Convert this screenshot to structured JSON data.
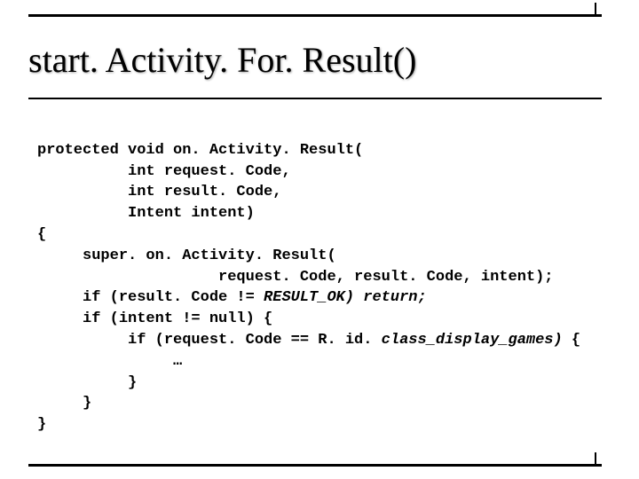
{
  "heading": "start. Activity. For. Result()",
  "code": {
    "l1": "protected void on. Activity. Result(",
    "l2": "          int request. Code,",
    "l3": "          int result. Code,",
    "l4": "          Intent intent)",
    "l5": "{",
    "l6": "     super. on. Activity. Result(",
    "l7": "                    request. Code, result. Code, intent);",
    "l8a": "     if (result. Code != ",
    "l8b": "RESULT_OK) return;",
    "l9": "     if (intent != null) {",
    "l10a": "          if (request. Code == R. id. ",
    "l10b": "class_display_games) ",
    "l10c": "{",
    "l11": "               …",
    "l12": "          }",
    "l13": "     }",
    "l14": "}"
  }
}
